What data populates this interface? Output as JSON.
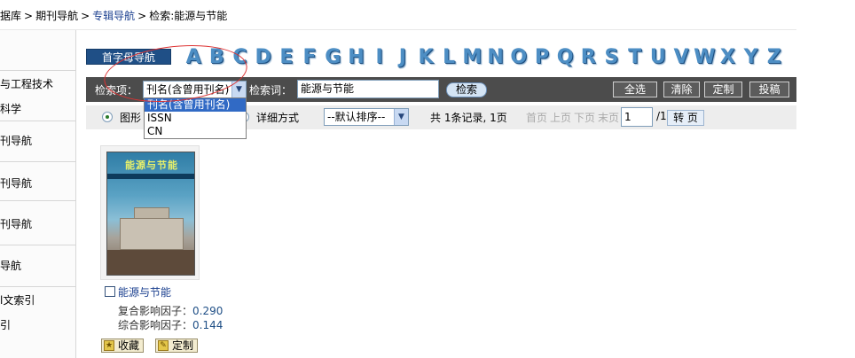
{
  "breadcrumb": {
    "items": [
      "据库",
      "期刊导航",
      "专辑导航",
      "检索:能源与节能"
    ],
    "separator": ">"
  },
  "sidebar": {
    "items": [
      "与工程技术",
      "科学",
      "刊导航",
      "刊导航",
      "刊导航",
      "导航",
      "l文索引",
      "引"
    ]
  },
  "alphabet": {
    "label": "首字母导航",
    "letters": [
      "A",
      "B",
      "C",
      "D",
      "E",
      "F",
      "G",
      "H",
      "I",
      "J",
      "K",
      "L",
      "M",
      "N",
      "O",
      "P",
      "Q",
      "R",
      "S",
      "T",
      "U",
      "V",
      "W",
      "X",
      "Y",
      "Z"
    ]
  },
  "search": {
    "field_label": "检索项：",
    "field_selected": "刊名(含曾用刊名)",
    "keyword_label": "检索词：",
    "keyword_value": "能源与节能",
    "search_button": "检索",
    "dropdown_options": [
      "刊名(含曾用刊名)",
      "ISSN",
      "CN"
    ],
    "toolbar": {
      "select_all": "全选",
      "clear": "清除",
      "customize": "定制",
      "submit": "投稿"
    }
  },
  "view_options": {
    "graphic_label": "图形",
    "detail_label": "详细方式",
    "sort_selected": "--默认排序--",
    "summary": "共 1条记录, 1页",
    "pager": {
      "first": "首页",
      "prev": "上页",
      "next": "下页",
      "last": "末页",
      "current_page": "1",
      "total_pages": "/1",
      "go_button": "转 页"
    }
  },
  "results": [
    {
      "name": "能源与节能",
      "composite_if_label": "复合影响因子：",
      "composite_if_value": "0.290",
      "comprehensive_if_label": "综合影响因子：",
      "comprehensive_if_value": "0.144",
      "cover_title": "能源与节能"
    }
  ],
  "actions": {
    "collect": "收藏",
    "customize": "定制"
  },
  "colors": {
    "accent": "#1f4f86",
    "toolbar_bg": "#4c4c4c",
    "link": "#1a3f8f",
    "annotation": "#d33333"
  }
}
